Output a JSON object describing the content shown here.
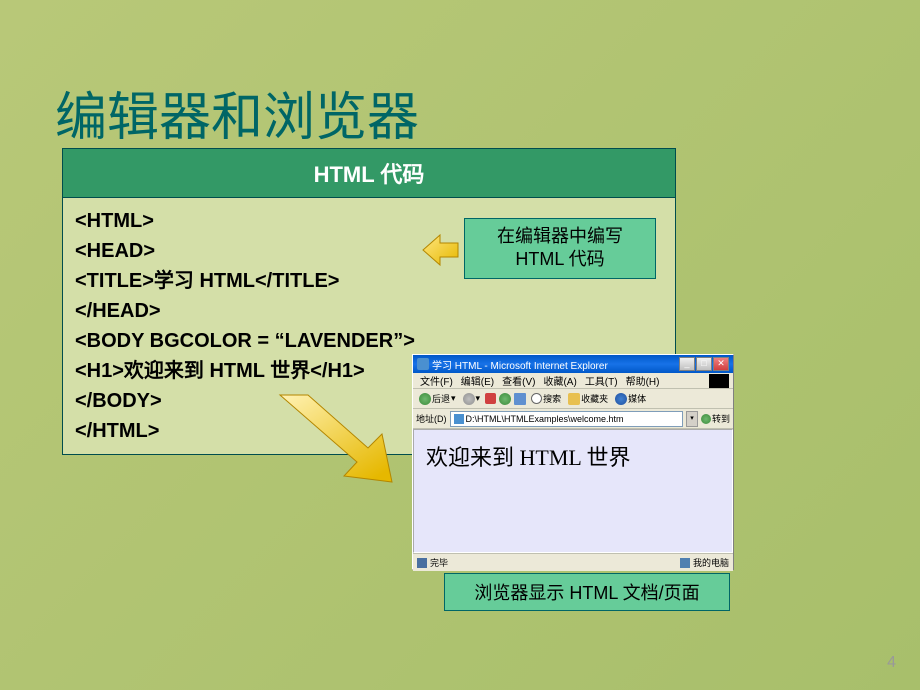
{
  "slide": {
    "title": "编辑器和浏览器",
    "page_number": "4"
  },
  "code_table": {
    "header": "HTML 代码",
    "lines": [
      "<HTML>",
      "<HEAD>",
      "<TITLE>学习 HTML</TITLE>",
      "</HEAD>",
      "<BODY BGCOLOR = “LAVENDER”>",
      "<H1>欢迎来到 HTML 世界</H1>",
      "</BODY>",
      "</HTML>"
    ]
  },
  "callouts": {
    "editor": {
      "line1": "在编辑器中编写",
      "line2": "HTML 代码"
    },
    "browser": "浏览器显示 HTML 文档/页面"
  },
  "browser": {
    "title": "学习 HTML - Microsoft Internet Explorer",
    "menu": {
      "file": "文件(F)",
      "edit": "编辑(E)",
      "view": "查看(V)",
      "favorites": "收藏(A)",
      "tools": "工具(T)",
      "help": "帮助(H)"
    },
    "toolbar": {
      "back": "后退",
      "search": "搜索",
      "favorites": "收藏夹",
      "media": "媒体"
    },
    "address": {
      "label": "地址(D)",
      "url": "D:\\HTML\\HTMLExamples\\welcome.htm",
      "go": "转到"
    },
    "content": "欢迎来到 HTML 世界",
    "status": {
      "done": "完毕",
      "zone": "我的电脑"
    }
  }
}
